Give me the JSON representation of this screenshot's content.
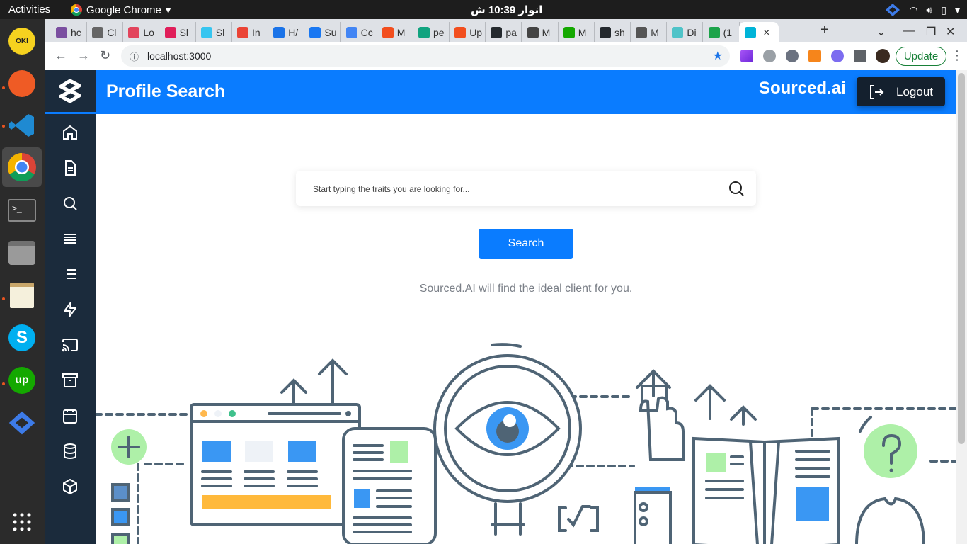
{
  "os": {
    "activities": "Activities",
    "app_name": "Google Chrome",
    "clock": "انوار 10:39 ش"
  },
  "browser": {
    "tabs": [
      {
        "label": "hc",
        "color": "#7b4fa0"
      },
      {
        "label": "Cl",
        "color": "#666666"
      },
      {
        "label": "Lo",
        "color": "#e2445c"
      },
      {
        "label": "Sl",
        "color": "#e01e5a"
      },
      {
        "label": "Sl",
        "color": "#36c5f0"
      },
      {
        "label": "In",
        "color": "#ea4335"
      },
      {
        "label": "H/",
        "color": "#1a73e8"
      },
      {
        "label": "Su",
        "color": "#1877f2"
      },
      {
        "label": "Cc",
        "color": "#4285f4"
      },
      {
        "label": "M",
        "color": "#f24e1e"
      },
      {
        "label": "pe",
        "color": "#10a37f"
      },
      {
        "label": "Up",
        "color": "#f24e1e"
      },
      {
        "label": "pa",
        "color": "#24292e"
      },
      {
        "label": "M",
        "color": "#444444"
      },
      {
        "label": "M",
        "color": "#14a800"
      },
      {
        "label": "sh",
        "color": "#24292e"
      },
      {
        "label": "M",
        "color": "#555555"
      },
      {
        "label": "Di",
        "color": "#4fc3c8"
      },
      {
        "label": "(1",
        "color": "#1ca34a"
      },
      {
        "label": "",
        "color": "#00b4d8"
      }
    ],
    "url": "localhost:3000",
    "update_label": "Update"
  },
  "app": {
    "title": "Profile Search",
    "brand": "Sourced.ai",
    "logout_label": "Logout",
    "search": {
      "placeholder": "Start typing the traits you are looking for...",
      "value": ""
    },
    "search_button": "Search",
    "tagline": "Sourced.AI will find the ideal client for you.",
    "sidebar_icons": [
      "home-icon",
      "document-icon",
      "search-icon",
      "menu-icon",
      "list-icon",
      "bolt-icon",
      "cast-icon",
      "archive-icon",
      "calendar-icon",
      "database-icon",
      "package-icon"
    ],
    "colors": {
      "primary": "#0a7cff",
      "sidebar": "#1b2b3c"
    }
  }
}
